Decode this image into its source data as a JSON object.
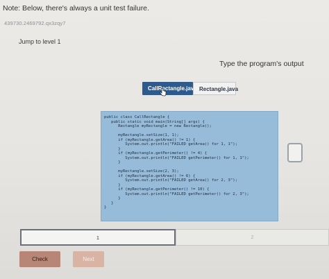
{
  "note": "Note: Below, there's always a unit test failure.",
  "meta_id": "439730.2469792.qx3zqy7",
  "jump_label": "Jump to level 1",
  "prompt": "Type the program's output",
  "tabs": [
    {
      "label": "CallRectangle.java",
      "active": true
    },
    {
      "label": "Rectangle.java",
      "active": false
    }
  ],
  "code": "public class CallRectangle {\n   public static void main(String[] args) {\n      Rectangle myRectangle = new Rectangle();\n\n      myRectangle.setSize(1, 1);\n      if (myRectangle.getArea() != 1) {\n         System.out.println(\"FAILED getArea() for 1, 1\");\n      }\n      if (myRectangle.getPerimeter() != 4) {\n         System.out.println(\"FAILED getPerimeter() for 1, 1\");\n      }\n\n      myRectangle.setSize(2, 3);\n      if (myRectangle.getArea() != 6) {\n         System.out.println(\"FAILED getArea() for 2, 3\");\n      }\n      if (myRectangle.getPerimeter() != 10) {\n         System.out.println(\"FAILED getPerimeter() for 2, 3\");\n      }\n   }\n}",
  "levels": [
    "1",
    "2"
  ],
  "buttons": {
    "check": "Check",
    "next": "Next"
  },
  "colors": {
    "tab_active": "#2f5b8c",
    "code_bg": "#97bcd9",
    "check_bg": "#b78676",
    "next_bg": "#d9b3a4"
  },
  "icons": {
    "cursor": "hand-pointer-icon"
  }
}
